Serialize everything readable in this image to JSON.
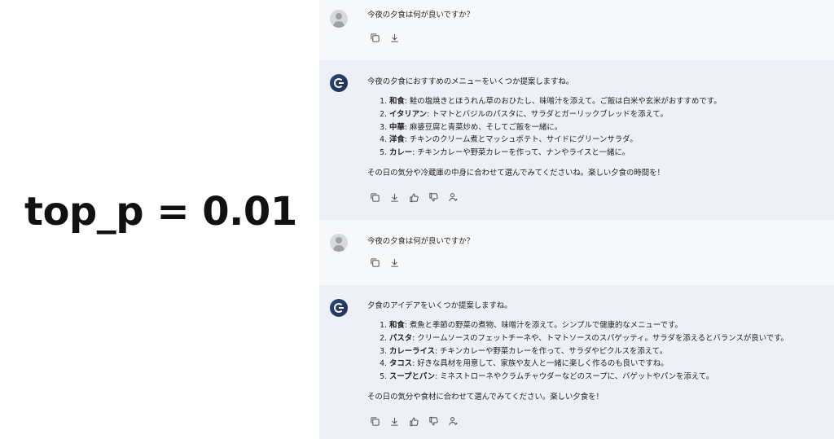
{
  "side_label": "top_p = 0.01",
  "conversation": [
    {
      "user": {
        "text": "今夜の夕食は何が良いですか？"
      },
      "assistant": {
        "intro": "今夜の夕食におすすめのメニューをいくつか提案しますね。",
        "items": [
          {
            "head": "和食",
            "body": ": 鮭の塩焼きとほうれん草のおひたし、味噌汁を添えて。ご飯は白米や玄米がおすすめです。"
          },
          {
            "head": "イタリアン",
            "body": ": トマトとバジルのパスタに、サラダとガーリックブレッドを添えて。"
          },
          {
            "head": "中華",
            "body": ": 麻婆豆腐と青菜炒め、そしてご飯を一緒に。"
          },
          {
            "head": "洋食",
            "body": ": チキンのクリーム煮とマッシュポテト、サイドにグリーンサラダ。"
          },
          {
            "head": "カレー",
            "body": ": チキンカレーや野菜カレーを作って、ナンやライスと一緒に。"
          }
        ],
        "outro": "その日の気分や冷蔵庫の中身に合わせて選んでみてくださいね。楽しい夕食の時間を！"
      }
    },
    {
      "user": {
        "text": "今夜の夕食は何が良いですか？"
      },
      "assistant": {
        "intro": "夕食のアイデアをいくつか提案しますね。",
        "items": [
          {
            "head": "和食",
            "body": ": 煮魚と季節の野菜の煮物、味噌汁を添えて。シンプルで健康的なメニューです。"
          },
          {
            "head": "パスタ",
            "body": ": クリームソースのフェットチーネや、トマトソースのスパゲッティ。サラダを添えるとバランスが良いです。"
          },
          {
            "head": "カレーライス",
            "body": ": チキンカレーや野菜カレーを作って、サラダやピクルスを添えて。"
          },
          {
            "head": "タコス",
            "body": ": 好きな具材を用意して、家族や友人と一緒に楽しく作るのも良いですね。"
          },
          {
            "head": "スープとパン",
            "body": ": ミネストローネやクラムチャウダーなどのスープに、バゲットやパンを添えて。"
          }
        ],
        "outro": "その日の気分や食材に合わせて選んでみてください。楽しい夕食を！"
      }
    }
  ],
  "icons": {
    "user_actions": [
      "copy-icon",
      "download-icon"
    ],
    "assistant_actions": [
      "copy-icon",
      "download-icon",
      "thumbs-up-icon",
      "thumbs-down-icon",
      "speaker-icon"
    ]
  }
}
